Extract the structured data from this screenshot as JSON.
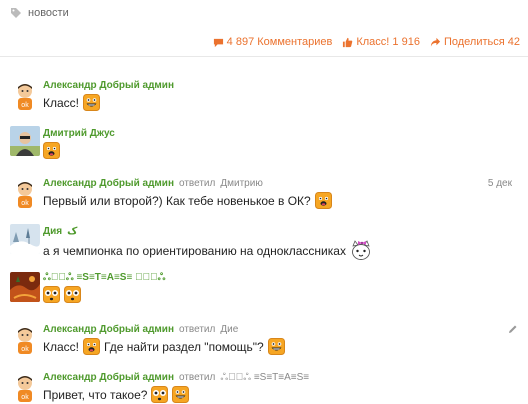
{
  "tag": {
    "label": "новости",
    "icon": "tag-icon"
  },
  "actions": {
    "comments": {
      "label": "4 897 Комментариев",
      "icon": "comment-icon"
    },
    "like": {
      "label": "Класс! 1 916",
      "icon": "thumbs-up-icon"
    },
    "share": {
      "label": "Поделиться 42",
      "icon": "share-icon"
    }
  },
  "colors": {
    "accent": "#eb722e",
    "author": "#4f9a2d"
  },
  "comments": [
    {
      "author": "Александр Добрый админ",
      "reply_prefix": "",
      "reply_name": "",
      "date": "",
      "text": "Класс!",
      "emoji": "laughing-smiley-icon"
    },
    {
      "author": "Дмитрий Джус",
      "reply_prefix": "",
      "reply_name": "",
      "date": "",
      "text": "",
      "emoji": "cheeky-smiley-icon"
    },
    {
      "author": "Александр Добрый админ",
      "reply_prefix": "ответил",
      "reply_name": "Дмитрию",
      "date": "5 дек",
      "text": "Первый или второй?) Как тебе новенькое в ОК?",
      "emoji": "cheeky-smiley-icon"
    },
    {
      "author": "Дия",
      "author_deco": "ک",
      "reply_prefix": "",
      "reply_name": "",
      "date": "",
      "text": "а я чемпионка по ориентированию на одноклассниках",
      "emoji": "cat-bow-icon"
    },
    {
      "author": "ஃ۞ۗஃ ≡S≡T≡A≡S≡ ۞ۗ۩ஃ",
      "reply_prefix": "",
      "reply_name": "",
      "date": "",
      "text": "",
      "emoji": "scared-smiley-icon"
    },
    {
      "author": "Александр Добрый админ",
      "reply_prefix": "ответил",
      "reply_name": "Дие",
      "date": "",
      "text_before": "Класс!",
      "text": "Где найти раздел \"помощь\"?",
      "emoji": "laughing-smiley-icon"
    },
    {
      "author": "Александр Добрый админ",
      "reply_prefix": "ответил",
      "reply_name": "ஃ۞ۗஃ ≡S≡T≡A≡S≡",
      "date": "",
      "text": "Привет, что такое?",
      "emoji": "scared-smiley-icon"
    }
  ]
}
